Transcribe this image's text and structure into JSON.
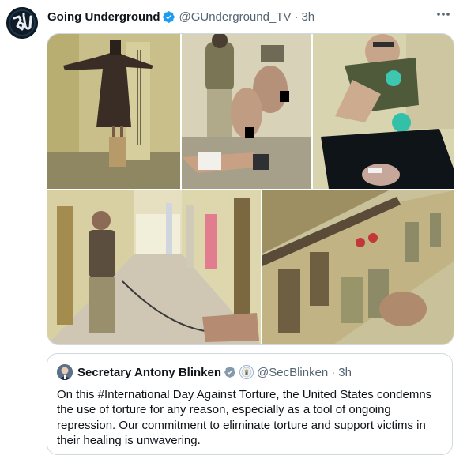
{
  "tweet": {
    "author_name": "Going Underground",
    "handle": "@GUnderground_TV",
    "separator": "·",
    "time": "3h",
    "avatar_text": "GU"
  },
  "quoted": {
    "author_name": "Secretary Antony Blinken",
    "handle": "@SecBlinken",
    "separator": "·",
    "time": "3h",
    "text": "On this #International Day Against Torture, the United States condemns the use of torture for any reason, especially as a tool of ongoing repression. Our commitment to eliminate torture and support victims in their healing is unwavering."
  },
  "colors": {
    "verified_blue": "#1d9bf0",
    "verified_grey": "#829aab",
    "muted_text": "#536471",
    "border": "#cfd9de"
  },
  "icons": [
    "verified-badge-icon",
    "more-options-icon",
    "government-badge-icon",
    "us-seal-icon"
  ]
}
